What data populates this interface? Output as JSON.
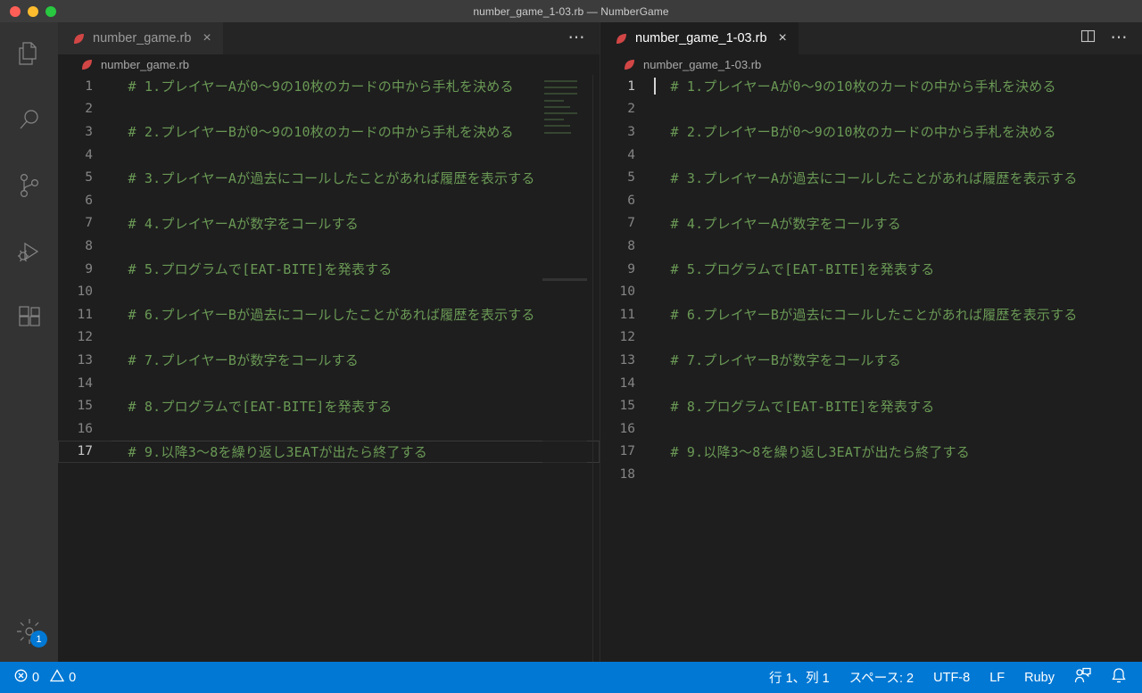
{
  "window": {
    "title": "number_game_1-03.rb — NumberGame",
    "traffic_lights": [
      "close-red",
      "minimize-yellow",
      "maximize-green"
    ]
  },
  "activity_bar": {
    "items": [
      {
        "name": "explorer",
        "icon": "files-icon"
      },
      {
        "name": "search",
        "icon": "search-icon"
      },
      {
        "name": "source-control",
        "icon": "source-control-icon"
      },
      {
        "name": "run-and-debug",
        "icon": "run-debug-icon"
      },
      {
        "name": "extensions",
        "icon": "extensions-icon"
      }
    ],
    "manage": {
      "icon": "gear-icon",
      "badge": "1"
    }
  },
  "editor_groups": [
    {
      "id": "left",
      "tab": {
        "label": "number_game.rb",
        "icon": "ruby-icon",
        "close": "×",
        "active": false
      },
      "actions": {
        "kebab": "⋯"
      },
      "breadcrumb": {
        "label": "number_game.rb",
        "icon": "ruby-icon"
      },
      "active_line": 17,
      "cursor_visible": false,
      "lines": [
        {
          "n": "1",
          "text": "# 1.プレイヤーAが0〜9の10枚のカードの中から手札を決める"
        },
        {
          "n": "2",
          "text": ""
        },
        {
          "n": "3",
          "text": "# 2.プレイヤーBが0〜9の10枚のカードの中から手札を決める"
        },
        {
          "n": "4",
          "text": ""
        },
        {
          "n": "5",
          "text": "# 3.プレイヤーAが過去にコールしたことがあれば履歴を表示する"
        },
        {
          "n": "6",
          "text": ""
        },
        {
          "n": "7",
          "text": "# 4.プレイヤーAが数字をコールする"
        },
        {
          "n": "8",
          "text": ""
        },
        {
          "n": "9",
          "text": "# 5.プログラムで[EAT-BITE]を発表する"
        },
        {
          "n": "10",
          "text": ""
        },
        {
          "n": "11",
          "text": "# 6.プレイヤーBが過去にコールしたことがあれば履歴を表示する"
        },
        {
          "n": "12",
          "text": ""
        },
        {
          "n": "13",
          "text": "# 7.プレイヤーBが数字をコールする"
        },
        {
          "n": "14",
          "text": ""
        },
        {
          "n": "15",
          "text": "# 8.プログラムで[EAT-BITE]を発表する"
        },
        {
          "n": "16",
          "text": ""
        },
        {
          "n": "17",
          "text": "# 9.以降3〜8を繰り返し3EATが出たら終了する"
        }
      ]
    },
    {
      "id": "right",
      "tab": {
        "label": "number_game_1-03.rb",
        "icon": "ruby-icon",
        "close": "×",
        "active": true
      },
      "actions": {
        "split_editor": "split-editor-icon",
        "kebab": "⋯"
      },
      "breadcrumb": {
        "label": "number_game_1-03.rb",
        "icon": "ruby-icon"
      },
      "active_line": 1,
      "cursor_visible": true,
      "lines": [
        {
          "n": "1",
          "text": "# 1.プレイヤーAが0〜9の10枚のカードの中から手札を決める"
        },
        {
          "n": "2",
          "text": ""
        },
        {
          "n": "3",
          "text": "# 2.プレイヤーBが0〜9の10枚のカードの中から手札を決める"
        },
        {
          "n": "4",
          "text": ""
        },
        {
          "n": "5",
          "text": "# 3.プレイヤーAが過去にコールしたことがあれば履歴を表示する"
        },
        {
          "n": "6",
          "text": ""
        },
        {
          "n": "7",
          "text": "# 4.プレイヤーAが数字をコールする"
        },
        {
          "n": "8",
          "text": ""
        },
        {
          "n": "9",
          "text": "# 5.プログラムで[EAT-BITE]を発表する"
        },
        {
          "n": "10",
          "text": ""
        },
        {
          "n": "11",
          "text": "# 6.プレイヤーBが過去にコールしたことがあれば履歴を表示する"
        },
        {
          "n": "12",
          "text": ""
        },
        {
          "n": "13",
          "text": "# 7.プレイヤーBが数字をコールする"
        },
        {
          "n": "14",
          "text": ""
        },
        {
          "n": "15",
          "text": "# 8.プログラムで[EAT-BITE]を発表する"
        },
        {
          "n": "16",
          "text": ""
        },
        {
          "n": "17",
          "text": "# 9.以降3〜8を繰り返し3EATが出たら終了する"
        },
        {
          "n": "18",
          "text": ""
        }
      ]
    }
  ],
  "status_bar": {
    "errors": "0",
    "warnings": "0",
    "position": "行 1、列 1",
    "indentation": "スペース: 2",
    "encoding": "UTF-8",
    "eol": "LF",
    "language": "Ruby",
    "feedback_icon": "feedback-icon",
    "notifications_icon": "bell-icon"
  },
  "colors": {
    "status_bar_bg": "#0078d4",
    "comment_green": "#6a9955",
    "ruby_red": "#d24646",
    "titlebar_bg": "#3c3c3c",
    "activitybar_bg": "#333333",
    "editor_bg": "#1e1e1e"
  }
}
